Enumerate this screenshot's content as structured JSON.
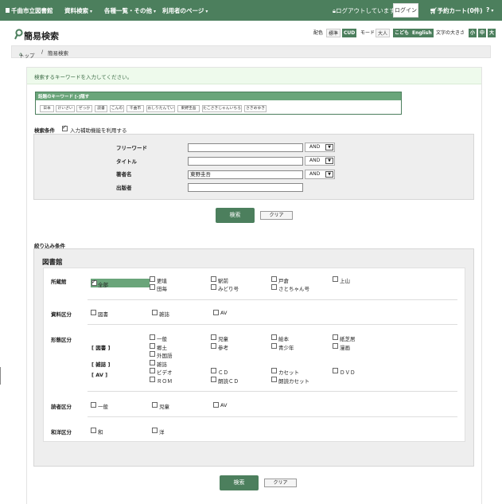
{
  "topbar": {
    "logo": "千曲市立図書館",
    "menus": [
      "資料検索",
      "各種一覧・その他",
      "利用者のページ"
    ],
    "status": "ログアウトしています",
    "login": "ログイン",
    "cart": "予約カート(0件)",
    "help": "?"
  },
  "header": {
    "title": "簡易検索",
    "color_label": "配色",
    "std": "標準",
    "cud": "CUD",
    "mode": "モード",
    "large": "大人",
    "kids": "こども",
    "english": "English",
    "size_label": "文字の大きさ",
    "size_s": "小",
    "size_m": "中",
    "size_l": "大"
  },
  "breadcrumb": {
    "home": "トップ",
    "sep": "/",
    "current": "簡易検索"
  },
  "notice": "検索するキーワードを入力してください。",
  "keywords": {
    "header": "話題のキーワード [-]隠す",
    "items": [
      "日本",
      "けいざい",
      "ぜっか",
      "読書",
      "こんの",
      "千曲市",
      "おしりたんてい",
      "東野圭吾",
      "たこさきじゃんいちろう",
      "さきめゆき"
    ]
  },
  "conditions": {
    "label": "検索条件",
    "assist": "入力補助機能を利用する",
    "fields": [
      {
        "label": "フリーワード",
        "value": "",
        "op": "AND"
      },
      {
        "label": "タイトル",
        "value": "",
        "op": "AND"
      },
      {
        "label": "著者名",
        "value": "東野圭吾",
        "op": "AND"
      },
      {
        "label": "出版者",
        "value": "",
        "op": ""
      }
    ],
    "search": "検索",
    "clear": "クリア"
  },
  "narrow": {
    "label": "絞り込み条件",
    "section": "図書館",
    "library": {
      "label": "所蔵館",
      "all": "全部",
      "options": [
        "更埴",
        "駅前",
        "戸倉",
        "上山",
        "田毎",
        "みどり号",
        "さとちゃん号"
      ]
    },
    "material": {
      "label": "資料区分",
      "options": [
        "図書",
        "雑誌",
        "AV"
      ]
    },
    "form": {
      "label": "形態区分",
      "group_book": "[ 図書 ]",
      "group_mag": "[ 雑誌 ]",
      "group_av": "[ AV ]",
      "book": [
        "一般",
        "児童",
        "絵本",
        "紙芝居",
        "郷土",
        "参考",
        "青少年",
        "漫画",
        "外国語"
      ],
      "mag": [
        "雑誌"
      ],
      "av": [
        "ビデオ",
        "ＣＤ",
        "カセット",
        "ＤＶＤ",
        "ＲＯＭ",
        "朗読ＣＤ",
        "朗読カセット"
      ]
    },
    "reader": {
      "label": "読者区分",
      "options": [
        "一般",
        "児童",
        "AV"
      ]
    },
    "lang": {
      "label": "和洋区分",
      "options": [
        "和",
        "洋"
      ]
    },
    "search": "検索",
    "clear": "クリア"
  },
  "colors": {
    "brand": "#4c7f5d",
    "accent": "#6aa57a"
  }
}
